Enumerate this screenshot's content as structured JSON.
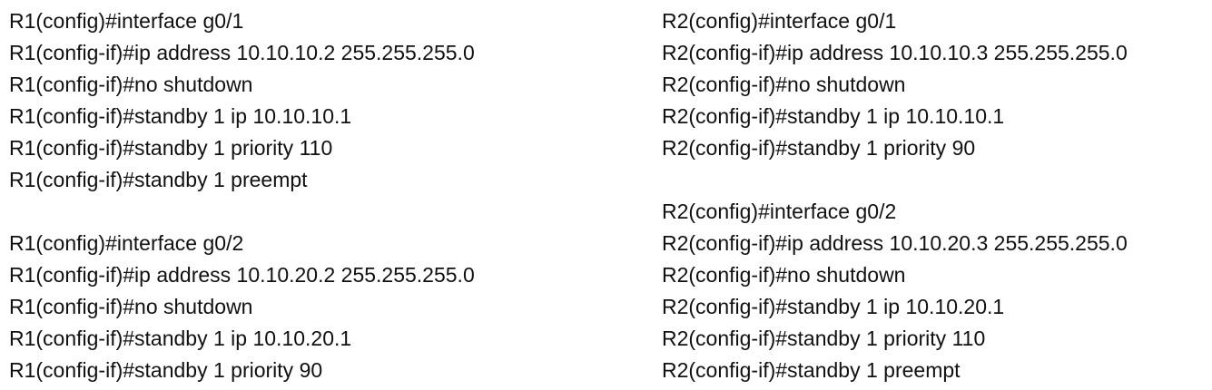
{
  "r1": {
    "block1": [
      "R1(config)#interface g0/1",
      "R1(config-if)#ip address 10.10.10.2 255.255.255.0",
      "R1(config-if)#no shutdown",
      "R1(config-if)#standby 1 ip 10.10.10.1",
      "R1(config-if)#standby 1 priority 110",
      "R1(config-if)#standby 1 preempt"
    ],
    "block2": [
      "R1(config)#interface g0/2",
      "R1(config-if)#ip address 10.10.20.2 255.255.255.0",
      "R1(config-if)#no shutdown",
      "R1(config-if)#standby 1 ip 10.10.20.1",
      "R1(config-if)#standby 1 priority 90"
    ]
  },
  "r2": {
    "block1": [
      "R2(config)#interface g0/1",
      "R2(config-if)#ip address 10.10.10.3 255.255.255.0",
      "R2(config-if)#no shutdown",
      "R2(config-if)#standby 1 ip 10.10.10.1",
      "R2(config-if)#standby 1 priority 90"
    ],
    "block2": [
      "R2(config)#interface g0/2",
      "R2(config-if)#ip address 10.10.20.3 255.255.255.0",
      "R2(config-if)#no shutdown",
      "R2(config-if)#standby 1 ip 10.10.20.1",
      "R2(config-if)#standby 1 priority 110",
      "R2(config-if)#standby 1 preempt"
    ]
  }
}
